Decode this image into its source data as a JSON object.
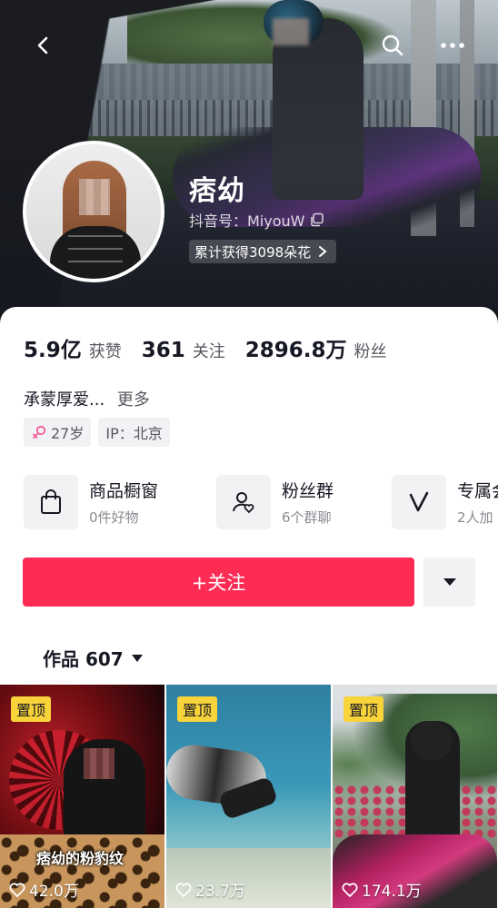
{
  "header": {
    "nickname": "痞幼",
    "douyin_id": "抖音号：MiyouW",
    "flowers": "累计获得3098朵花"
  },
  "stats": [
    {
      "value": "5.9亿",
      "label": "获赞"
    },
    {
      "value": "361",
      "label": "关注"
    },
    {
      "value": "2896.8万",
      "label": "粉丝"
    }
  ],
  "bio": {
    "text": "承蒙厚爱...",
    "more": "更多"
  },
  "tags": {
    "age": "27岁",
    "ip": "IP：北京"
  },
  "services": [
    {
      "title": "商品橱窗",
      "sub": "0件好物",
      "icon": "shopping-bag-icon"
    },
    {
      "title": "粉丝群",
      "sub": "6个群聊",
      "icon": "fan-group-icon"
    },
    {
      "title": "专属会",
      "sub": "2人加",
      "icon": "v-badge-icon"
    }
  ],
  "actions": {
    "follow": "+关注"
  },
  "works": {
    "label": "作品 607"
  },
  "videos": [
    {
      "pinned": "置顶",
      "likes": "42.0万",
      "caption": "痞幼的粉豹纹"
    },
    {
      "pinned": "置顶",
      "likes": "23.7万"
    },
    {
      "pinned": "置顶",
      "likes": "174.1万"
    }
  ],
  "colors": {
    "accent": "#fe2c55",
    "pin_badge": "#f8d33a"
  }
}
